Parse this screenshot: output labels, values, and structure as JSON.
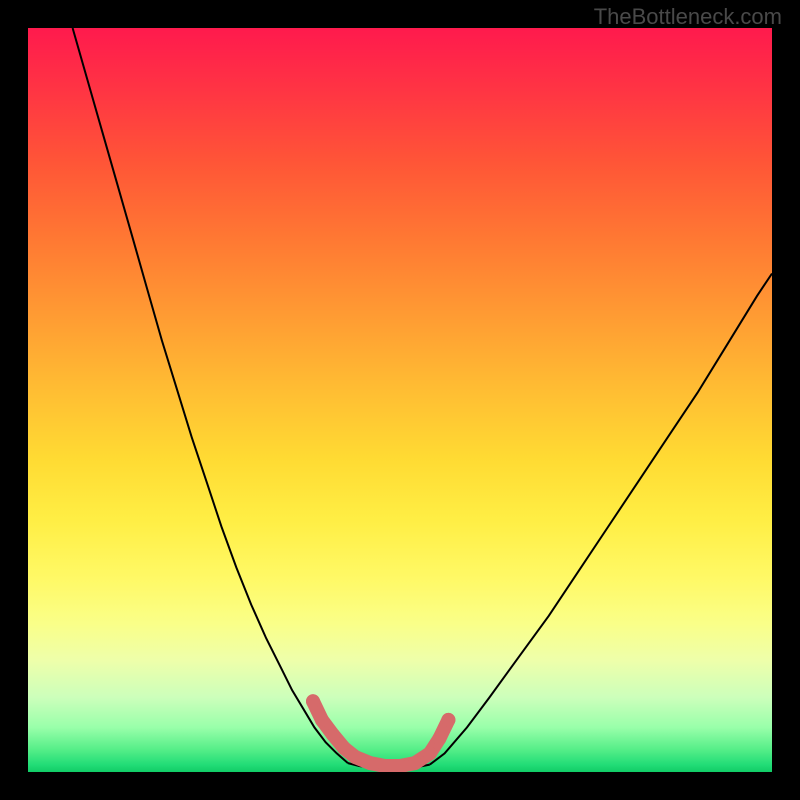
{
  "watermark": "TheBottleneck.com",
  "colors": {
    "curve": "#000000",
    "highlight": "#d66a6a",
    "frame": "#000000"
  },
  "chart_data": {
    "type": "line",
    "title": "",
    "xlabel": "",
    "ylabel": "",
    "xlim": [
      0,
      1
    ],
    "ylim": [
      0,
      1
    ],
    "series": [
      {
        "name": "left-curve",
        "x": [
          0.06,
          0.08,
          0.1,
          0.12,
          0.14,
          0.16,
          0.18,
          0.2,
          0.22,
          0.24,
          0.26,
          0.28,
          0.3,
          0.32,
          0.34,
          0.355,
          0.37,
          0.385,
          0.4,
          0.415,
          0.43
        ],
        "y": [
          1.0,
          0.93,
          0.86,
          0.79,
          0.72,
          0.65,
          0.58,
          0.515,
          0.45,
          0.39,
          0.33,
          0.275,
          0.225,
          0.18,
          0.14,
          0.11,
          0.085,
          0.06,
          0.04,
          0.025,
          0.012
        ]
      },
      {
        "name": "valley-floor",
        "x": [
          0.43,
          0.445,
          0.465,
          0.49,
          0.515,
          0.54
        ],
        "y": [
          0.012,
          0.008,
          0.005,
          0.004,
          0.005,
          0.01
        ]
      },
      {
        "name": "right-curve",
        "x": [
          0.54,
          0.56,
          0.59,
          0.62,
          0.66,
          0.7,
          0.74,
          0.78,
          0.82,
          0.86,
          0.9,
          0.94,
          0.98,
          1.0
        ],
        "y": [
          0.01,
          0.025,
          0.06,
          0.1,
          0.155,
          0.21,
          0.27,
          0.33,
          0.39,
          0.45,
          0.51,
          0.575,
          0.64,
          0.67
        ]
      },
      {
        "name": "highlight-segment",
        "x": [
          0.383,
          0.395,
          0.41,
          0.425,
          0.44,
          0.46,
          0.48,
          0.5,
          0.52,
          0.54,
          0.553,
          0.565
        ],
        "y": [
          0.095,
          0.07,
          0.05,
          0.032,
          0.02,
          0.012,
          0.008,
          0.008,
          0.012,
          0.025,
          0.045,
          0.07
        ]
      }
    ]
  }
}
